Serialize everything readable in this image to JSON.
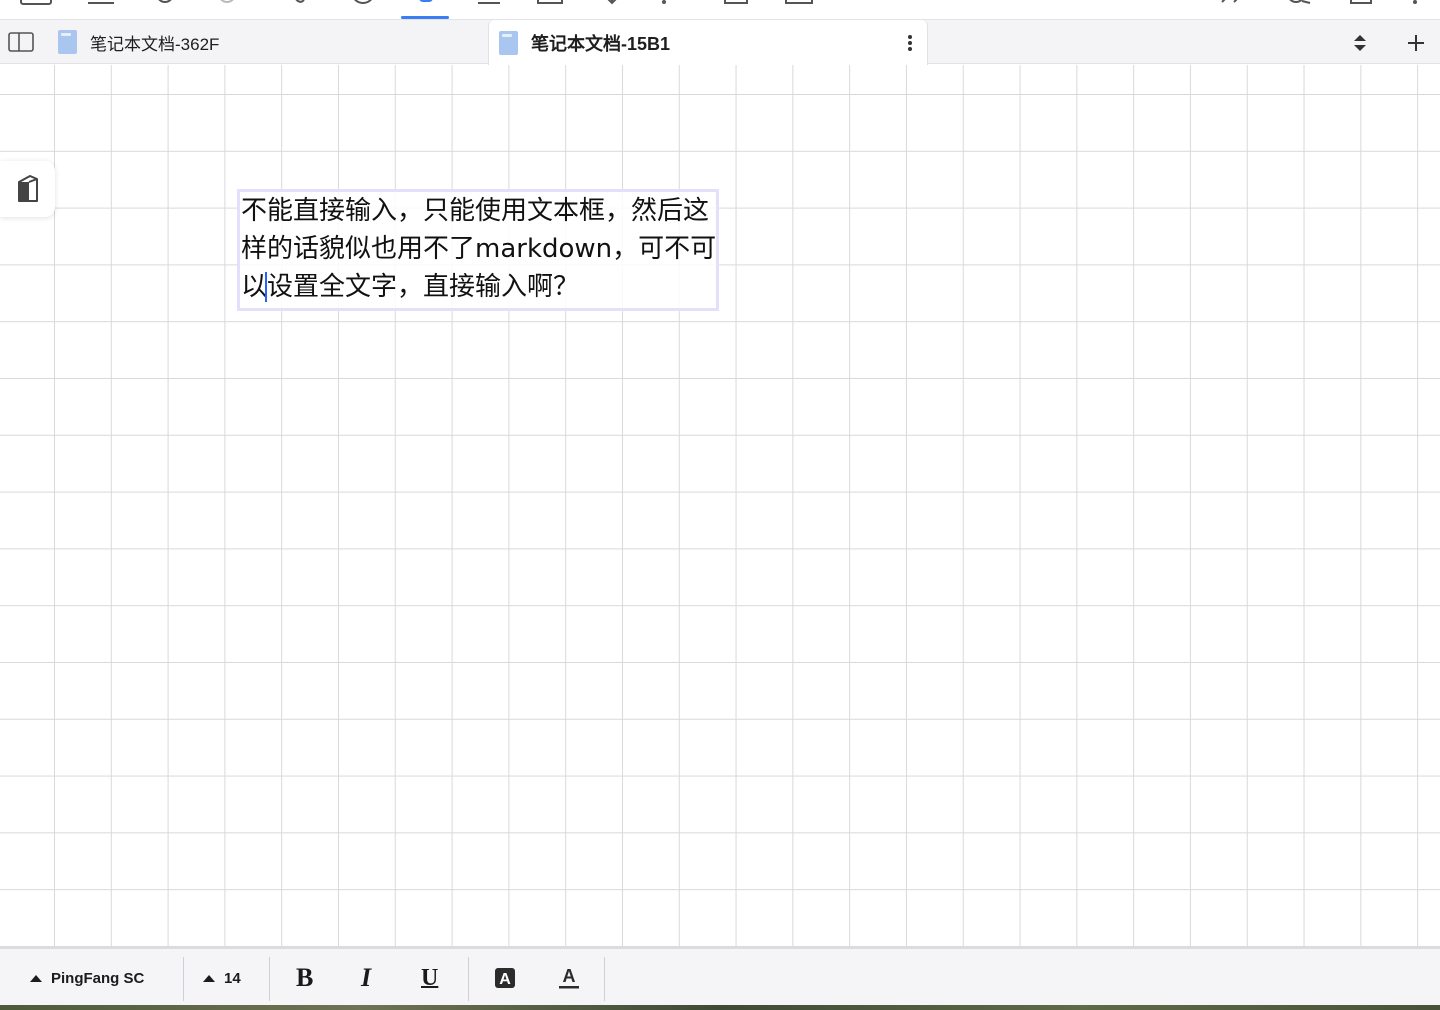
{
  "tabs": [
    {
      "label": "笔记本文档-362F",
      "active": false
    },
    {
      "label": "笔记本文档-15B1",
      "active": true
    }
  ],
  "canvas": {
    "textbox": {
      "line1": "不能直接输入，只能使用文本框，然后这",
      "line2": "样的话貌似也用不了markdown，可不可",
      "line3": "以设置全文字，直接输入啊？"
    }
  },
  "format_bar": {
    "font_name": "PingFang SC",
    "font_size": "14",
    "bold_label": "B",
    "italic_label": "I",
    "underline_label": "U",
    "highlight_label": "A",
    "color_label": "A"
  },
  "colors": {
    "accent": "#3c7cf4",
    "textbox_border": "#e3e0fb",
    "grid_line": "#d9d9dd",
    "caret": "#2a60ff"
  },
  "icons": {
    "sidebar_toggle": "sidebar-toggle-icon",
    "doc": "notebook-document-icon",
    "more": "vertical-ellipsis-icon",
    "sort": "up-down-chevron-icon",
    "add": "plus-icon",
    "side_float": "notebook-icon"
  }
}
